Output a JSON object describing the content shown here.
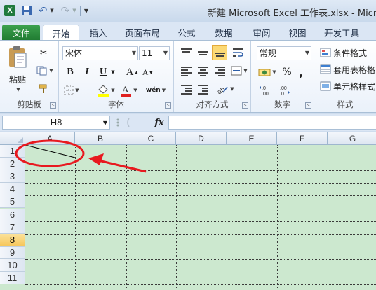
{
  "window": {
    "title": "新建 Microsoft Excel 工作表.xlsx - Micr"
  },
  "quick_access": {
    "app_icon": "X",
    "icons": [
      "excel-app-icon",
      "save-icon",
      "undo-icon",
      "redo-icon",
      "customize-icon"
    ]
  },
  "tabs": [
    {
      "label": "文件"
    },
    {
      "label": "开始"
    },
    {
      "label": "插入"
    },
    {
      "label": "页面布局"
    },
    {
      "label": "公式"
    },
    {
      "label": "数据"
    },
    {
      "label": "审阅"
    },
    {
      "label": "视图"
    },
    {
      "label": "开发工具"
    }
  ],
  "ribbon": {
    "clipboard": {
      "label": "剪贴板",
      "paste": "粘贴"
    },
    "font": {
      "label": "字体",
      "name": "宋体",
      "size": "11",
      "bold": "B",
      "italic": "I",
      "underline": "U",
      "grow": "A",
      "shrink": "A",
      "phonetic": "wén"
    },
    "alignment": {
      "label": "对齐方式"
    },
    "number": {
      "label": "数字",
      "format": "常规",
      "currency": "¥",
      "percent": "%",
      "comma": ",",
      "increase_decimal": ".0\n.00",
      "decrease_decimal": ".00\n.0"
    },
    "styles": {
      "label": "样式",
      "conditional": "条件格式",
      "as_table": "套用表格格",
      "cell_styles": "单元格样式"
    }
  },
  "formula_bar": {
    "name_box": "H8",
    "fx": "fx",
    "value": ""
  },
  "grid": {
    "columns": [
      "A",
      "B",
      "C",
      "D",
      "E",
      "F",
      "G"
    ],
    "rows": [
      "1",
      "2",
      "3",
      "4",
      "5",
      "6",
      "7",
      "8",
      "9",
      "10",
      "11"
    ],
    "active_row": "8",
    "cell_bg": "#cce8cf",
    "annotation_color": "#e8191f"
  }
}
